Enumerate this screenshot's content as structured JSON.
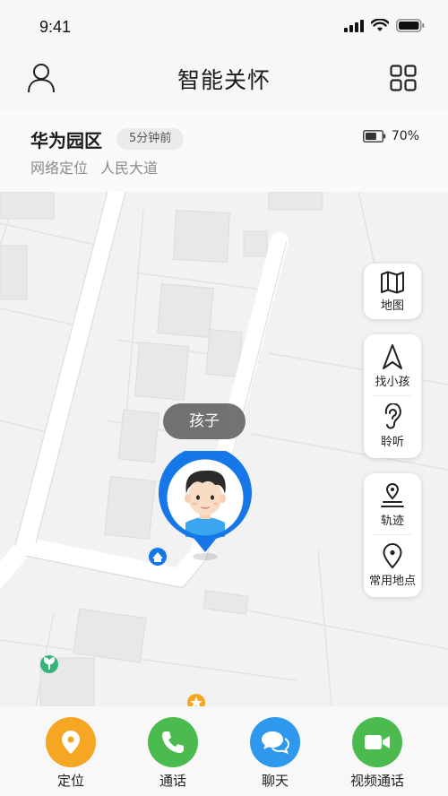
{
  "status_bar": {
    "time": "9:41"
  },
  "nav": {
    "title": "智能关怀"
  },
  "info": {
    "location_name": "华为园区",
    "time_badge": "5分钟前",
    "battery_percent": "70%",
    "battery_level": 0.7,
    "method": "网络定位",
    "street": "人民大道"
  },
  "map": {
    "child_label": "孩子"
  },
  "side_buttons": {
    "map": "地图",
    "find_child": "找小孩",
    "listen": "聆听",
    "track": "轨迹",
    "places": "常用地点"
  },
  "tabs": {
    "locate": "定位",
    "call": "通话",
    "chat": "聊天",
    "video": "视频通话"
  },
  "colors": {
    "accent_blue": "#1677e8",
    "locate_orange": "#f5a623",
    "call_green": "#4cbb4f",
    "chat_blue": "#2e98ee",
    "video_green": "#4cbb4f"
  },
  "icons": [
    "user-icon",
    "grid-icon",
    "battery-icon",
    "map-icon",
    "navigation-icon",
    "ear-icon",
    "track-icon",
    "location-pin-icon",
    "phone-icon",
    "chat-icon",
    "video-icon"
  ]
}
